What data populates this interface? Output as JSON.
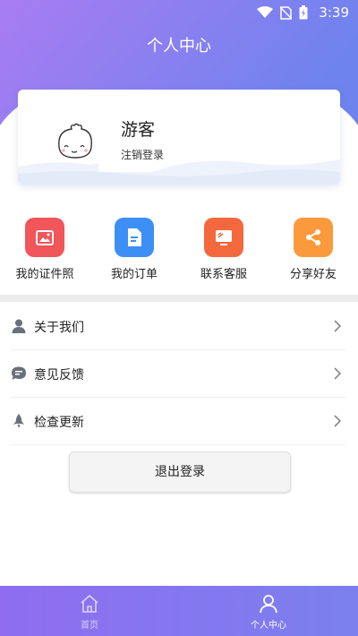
{
  "status_bar": {
    "time": "3:39"
  },
  "header": {
    "title": "个人中心"
  },
  "profile": {
    "name": "游客",
    "logout_link": "注销登录"
  },
  "quick_actions": [
    {
      "label": "我的证件照",
      "icon": "photo-icon",
      "color": "#f0565a"
    },
    {
      "label": "我的订单",
      "icon": "document-icon",
      "color": "#3d8ff5"
    },
    {
      "label": "联系客服",
      "icon": "monitor-icon",
      "color": "#f4683d"
    },
    {
      "label": "分享好友",
      "icon": "share-icon",
      "color": "#fb9a3c"
    }
  ],
  "menu": [
    {
      "label": "关于我们",
      "icon": "user-icon"
    },
    {
      "label": "意见反馈",
      "icon": "chat-icon"
    },
    {
      "label": "检查更新",
      "icon": "rocket-icon"
    }
  ],
  "exit_button": {
    "label": "退出登录"
  },
  "tab_bar": {
    "tabs": [
      {
        "label": "首页",
        "icon": "home-icon",
        "active": false
      },
      {
        "label": "个人中心",
        "icon": "profile-icon",
        "active": true
      }
    ]
  },
  "colors": {
    "gradient_start": "#a97cf2",
    "gradient_end": "#6f83ee"
  }
}
